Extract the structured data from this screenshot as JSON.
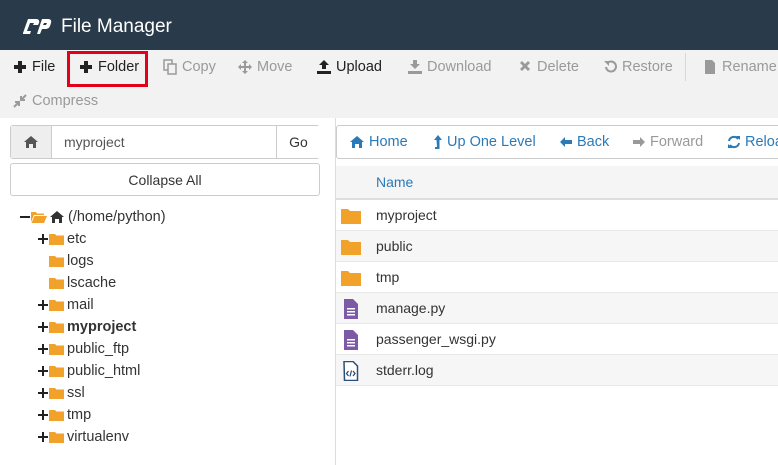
{
  "header": {
    "title": "File Manager"
  },
  "toolbar": {
    "file": "File",
    "folder": "Folder",
    "copy": "Copy",
    "move": "Move",
    "upload": "Upload",
    "download": "Download",
    "delete": "Delete",
    "restore": "Restore",
    "rename": "Rename",
    "compress": "Compress"
  },
  "left": {
    "path_value": "myproject",
    "go_label": "Go",
    "collapse_label": "Collapse All",
    "tree": {
      "root": "(/home/python)",
      "items": [
        "etc",
        "logs",
        "lscache",
        "mail",
        "myproject",
        "public_ftp",
        "public_html",
        "ssl",
        "tmp",
        "virtualenv"
      ]
    }
  },
  "nav": {
    "home": "Home",
    "up": "Up One Level",
    "back": "Back",
    "forward": "Forward",
    "reload": "Reload"
  },
  "table": {
    "header_name": "Name",
    "rows": [
      "myproject",
      "public",
      "tmp",
      "manage.py",
      "passenger_wsgi.py",
      "stderr.log"
    ]
  },
  "colors": {
    "header_bg": "#293a4a",
    "link": "#2a7ab8",
    "folder": "#f0a22b",
    "file": "#7c5aa6",
    "highlight": "#e3001b"
  }
}
